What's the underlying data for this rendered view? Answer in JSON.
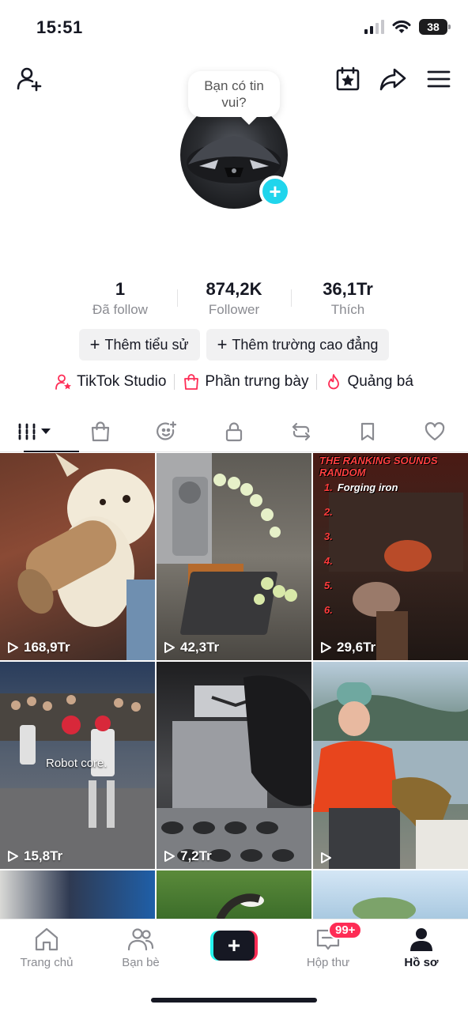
{
  "status_bar": {
    "time": "15:51",
    "battery": "38"
  },
  "header": {
    "add_friend_icon": "person-plus-icon",
    "calendar_icon": "calendar-star-icon",
    "share_icon": "share-arrow-icon",
    "menu_icon": "hamburger-menu-icon"
  },
  "avatar": {
    "bubble_text": "Bạn có tin vui?",
    "plus": "+"
  },
  "stats": [
    {
      "value": "1",
      "label": "Đã follow"
    },
    {
      "value": "874,2K",
      "label": "Follower"
    },
    {
      "value": "36,1Tr",
      "label": "Thích"
    }
  ],
  "actions": [
    {
      "label": "Thêm tiểu sử"
    },
    {
      "label": "Thêm trường cao đẳng"
    }
  ],
  "links": [
    {
      "label": "TikTok Studio",
      "icon": "person-star-icon"
    },
    {
      "label": "Phần trưng bày",
      "icon": "shopping-bag-icon"
    },
    {
      "label": "Quảng bá",
      "icon": "flame-icon"
    }
  ],
  "tabs": [
    {
      "name": "videos",
      "icon": "grid-bars-icon",
      "active": true
    },
    {
      "name": "shop",
      "icon": "shopping-bag-icon"
    },
    {
      "name": "favorites-sticker",
      "icon": "face-sparkle-icon"
    },
    {
      "name": "private",
      "icon": "lock-icon"
    },
    {
      "name": "reposts",
      "icon": "repost-icon"
    },
    {
      "name": "saved",
      "icon": "bookmark-icon"
    },
    {
      "name": "liked",
      "icon": "heart-icon"
    }
  ],
  "videos": [
    {
      "views": "168,9Tr",
      "scene": "dog-with-paper-tube"
    },
    {
      "views": "42,3Tr",
      "scene": "cucumber-slicer-machine"
    },
    {
      "views": "29,6Tr",
      "scene": "ranking-sounds",
      "overlay_title": "THE RANKING SOUNDS RANDOM",
      "ranking": [
        "Forging iron",
        "",
        "",
        "",
        "",
        ""
      ]
    },
    {
      "views": "15,8Tr",
      "scene": "robot-boxing",
      "caption": "Robot core."
    },
    {
      "views": "7,2Tr",
      "scene": "metal-block-gloves"
    },
    {
      "views": "",
      "scene": "woman-with-kelp"
    },
    {
      "views": "",
      "scene": "man-blue"
    },
    {
      "views": "",
      "scene": "grass-hand"
    },
    {
      "views": "",
      "scene": "sky-hand"
    }
  ],
  "bottom_nav": [
    {
      "label": "Trang chủ",
      "icon": "home-icon"
    },
    {
      "label": "Bạn bè",
      "icon": "friends-icon"
    },
    {
      "label": "",
      "icon": "create-plus-icon"
    },
    {
      "label": "Hộp thư",
      "icon": "inbox-icon",
      "badge": "99+"
    },
    {
      "label": "Hồ sơ",
      "icon": "profile-icon",
      "active": true
    }
  ],
  "colors": {
    "accent": "#fe2c55",
    "cyan": "#25f4ee",
    "plus_badge": "#20d5ec"
  }
}
